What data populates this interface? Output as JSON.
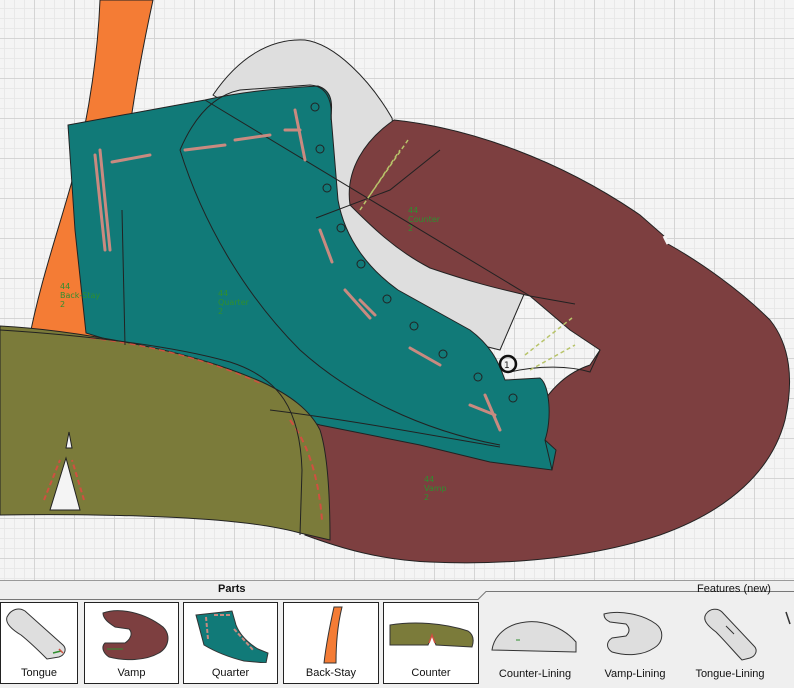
{
  "canvas": {
    "colors": {
      "vamp": "#7d3f40",
      "quarter": "#117a78",
      "back_stay": "#f47c35",
      "counter": "#7b7b3a",
      "lining": "#dedede",
      "stitch": "#c98a80",
      "stitch_green": "#b8c46a"
    },
    "labels": {
      "vamp": [
        "44",
        "Vamp",
        "2"
      ],
      "quarter": [
        "44",
        "Quarter",
        "2"
      ],
      "back_stay": [
        "44",
        "Back-Stay",
        "2"
      ],
      "counter_lining": [
        "44",
        "Counter",
        "2"
      ]
    },
    "marker_label": "1"
  },
  "tabs": {
    "parts": "Parts",
    "features": "Features (new)"
  },
  "thumbnails": [
    {
      "label": "Tongue",
      "icon": "tongue-shape-icon"
    },
    {
      "label": "Vamp",
      "icon": "vamp-shape-icon"
    },
    {
      "label": "Quarter",
      "icon": "quarter-shape-icon"
    },
    {
      "label": "Back-Stay",
      "icon": "back-stay-shape-icon"
    },
    {
      "label": "Counter",
      "icon": "counter-shape-icon"
    },
    {
      "label": "Counter-Lining",
      "icon": "counter-lining-shape-icon"
    },
    {
      "label": "Vamp-Lining",
      "icon": "vamp-lining-shape-icon"
    },
    {
      "label": "Tongue-Lining",
      "icon": "tongue-lining-shape-icon"
    }
  ]
}
